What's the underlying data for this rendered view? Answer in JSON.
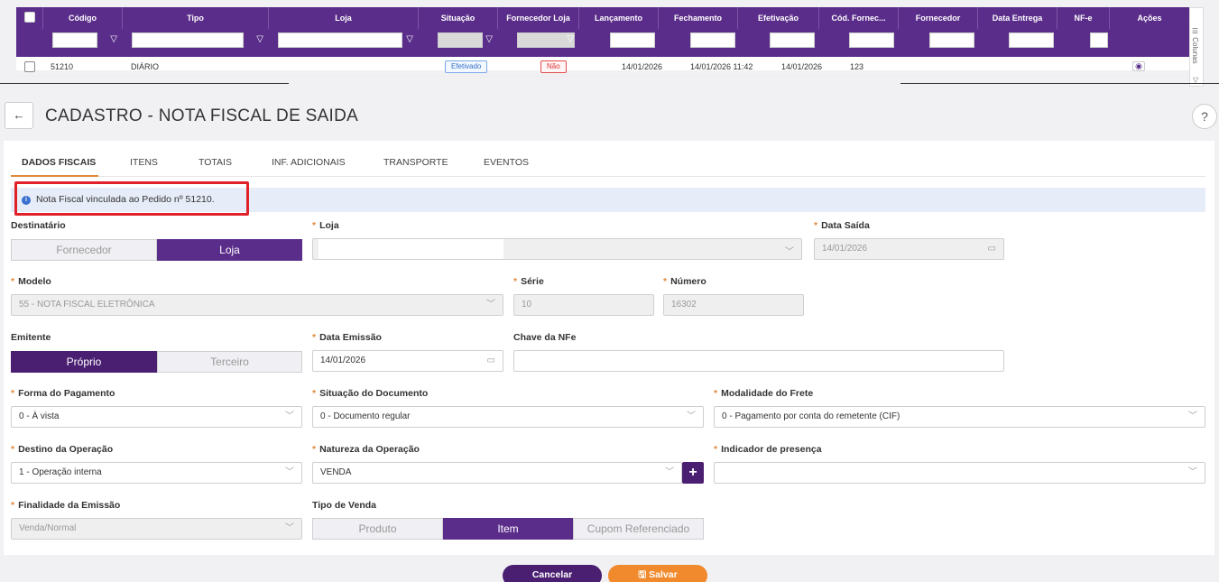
{
  "grid": {
    "columns": [
      "Código",
      "Tipo",
      "Loja",
      "Situação",
      "Fornecedor Loja",
      "Lançamento",
      "Fechamento",
      "Efetivação",
      "Cód. Fornec...",
      "Fornecedor",
      "Data Entrega",
      "NF-e",
      "Ações"
    ],
    "row": {
      "codigo": "51210",
      "tipo": "DIÁRIO",
      "situacao": "Efetivado",
      "fornecedor_loja": "Não",
      "lancamento": "14/01/2026",
      "fechamento": "14/01/2026 11:42",
      "efetivacao": "14/01/2026",
      "cod_fornec": "123"
    },
    "columns_button": "Colunas"
  },
  "header": {
    "title": "CADASTRO - NOTA FISCAL DE SAIDA",
    "back_icon": "arrow-left-icon",
    "help": "?"
  },
  "tabs": [
    "DADOS FISCAIS",
    "ITENS",
    "TOTAIS",
    "INF. ADICIONAIS",
    "TRANSPORTE",
    "EVENTOS"
  ],
  "info": {
    "message": "Nota Fiscal vinculada ao Pedido nº 51210.",
    "icon": "i"
  },
  "form": {
    "destinatario": {
      "label": "Destinatário",
      "options": [
        "Fornecedor",
        "Loja"
      ],
      "selected": "Loja"
    },
    "loja": {
      "label": "Loja",
      "value": ""
    },
    "data_saida": {
      "label": "Data Saída",
      "value": "14/01/2026"
    },
    "modelo": {
      "label": "Modelo",
      "value": "55 - NOTA FISCAL ELETRÔNICA"
    },
    "serie": {
      "label": "Série",
      "value": "10"
    },
    "numero": {
      "label": "Número",
      "value": "16302"
    },
    "emitente": {
      "label": "Emitente",
      "options": [
        "Próprio",
        "Terceiro"
      ],
      "selected": "Próprio"
    },
    "data_emissao": {
      "label": "Data Emissão",
      "value": "14/01/2026"
    },
    "chave_nfe": {
      "label": "Chave da NFe",
      "value": ""
    },
    "forma_pagamento": {
      "label": "Forma do Pagamento",
      "value": "0 - À vista"
    },
    "situacao_documento": {
      "label": "Situação do Documento",
      "value": "0 - Documento regular"
    },
    "modalidade_frete": {
      "label": "Modalidade do Frete",
      "value": "0 - Pagamento por conta do remetente (CIF)"
    },
    "destino_operacao": {
      "label": "Destino da Operação",
      "value": "1 - Operação interna"
    },
    "natureza_operacao": {
      "label": "Natureza da Operação",
      "value": "VENDA",
      "add": "+"
    },
    "indicador_presenca": {
      "label": "Indicador de presença",
      "value": ""
    },
    "finalidade_emissao": {
      "label": "Finalidade da Emissão",
      "value": "Venda/Normal"
    },
    "tipo_venda": {
      "label": "Tipo de Venda",
      "options": [
        "Produto",
        "Item",
        "Cupom Referenciado"
      ],
      "selected": "Item"
    }
  },
  "footer": {
    "cancel": "Cancelar",
    "save": "Salvar"
  },
  "colors": {
    "primary": "#5a2d8a",
    "accent": "#f08a2c",
    "info_bg": "#e6ecf8",
    "highlight": "#e0212a"
  }
}
